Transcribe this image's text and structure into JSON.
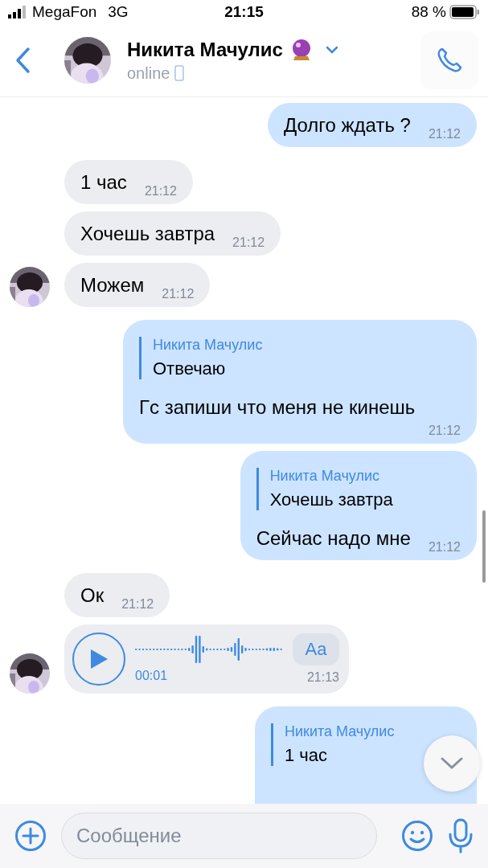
{
  "status_bar": {
    "carrier": "MegaFon",
    "network": "3G",
    "time": "21:15",
    "battery": "88 %"
  },
  "header": {
    "name": "Никита Мачулис",
    "status": "online"
  },
  "messages": [
    {
      "kind": "text",
      "outgoing": true,
      "text": "Долго ждать ?",
      "time": "21:12"
    },
    {
      "kind": "text",
      "outgoing": false,
      "avatar": false,
      "text": "1 час",
      "time": "21:12"
    },
    {
      "kind": "text",
      "outgoing": false,
      "avatar": false,
      "text": "Хочешь завтра",
      "time": "21:12"
    },
    {
      "kind": "text",
      "outgoing": false,
      "avatar": true,
      "text": "Можем",
      "time": "21:12"
    },
    {
      "kind": "reply",
      "outgoing": true,
      "quote_author": "Никита Мачулис",
      "quote_text": "Отвечаю",
      "text": "Гс запиши что меня не кинешь",
      "time": "21:12"
    },
    {
      "kind": "reply",
      "outgoing": true,
      "quote_author": "Никита Мачулис",
      "quote_text": "Хочешь завтра",
      "text": "Сейчас надо мне",
      "time": "21:12"
    },
    {
      "kind": "text",
      "outgoing": false,
      "avatar": false,
      "text": "Ок",
      "time": "21:12"
    },
    {
      "kind": "voice",
      "outgoing": false,
      "avatar": true,
      "duration": "00:01",
      "transcribe": "Aa",
      "time": "21:13"
    },
    {
      "kind": "reply",
      "outgoing": true,
      "quote_author": "Никита Мачулис",
      "quote_text": "1 час"
    }
  ],
  "composer": {
    "placeholder": "Сообщение"
  }
}
